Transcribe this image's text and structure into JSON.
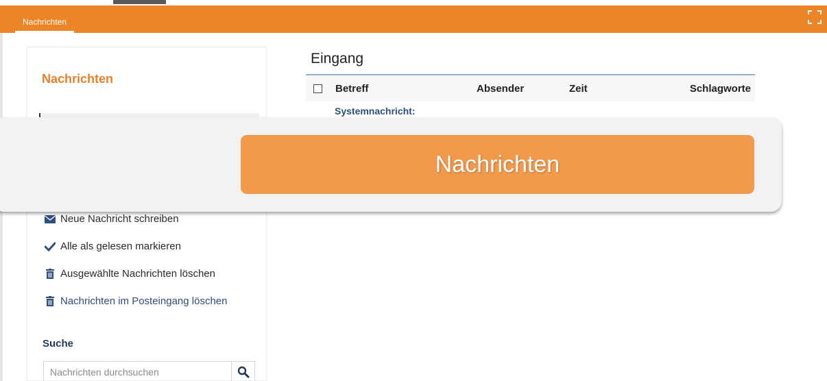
{
  "topbar": {
    "tab_label": "Nachrichten"
  },
  "sidebar": {
    "title": "Nachrichten",
    "actions": [
      {
        "label": "Neue Nachricht schreiben",
        "icon": "envelope-icon"
      },
      {
        "label": "Alle als gelesen markieren",
        "icon": "checkmark-icon"
      },
      {
        "label": "Ausgewählte Nachrichten löschen",
        "icon": "trash-icon"
      },
      {
        "label": "Nachrichten im Posteingang löschen",
        "icon": "trash-icon"
      }
    ],
    "search": {
      "label": "Suche",
      "placeholder": "Nachrichten durchsuchen"
    }
  },
  "main": {
    "title": "Eingang",
    "columns": [
      "Betreff",
      "Absender",
      "Zeit",
      "Schlagworte"
    ],
    "rows": [
      {
        "subject": "Systemnachricht:"
      }
    ]
  },
  "overlay": {
    "label": "Nachrichten"
  },
  "colors": {
    "accent": "#ec8525",
    "overlay_button": "#f19a4c",
    "link": "#2e4e7d"
  }
}
